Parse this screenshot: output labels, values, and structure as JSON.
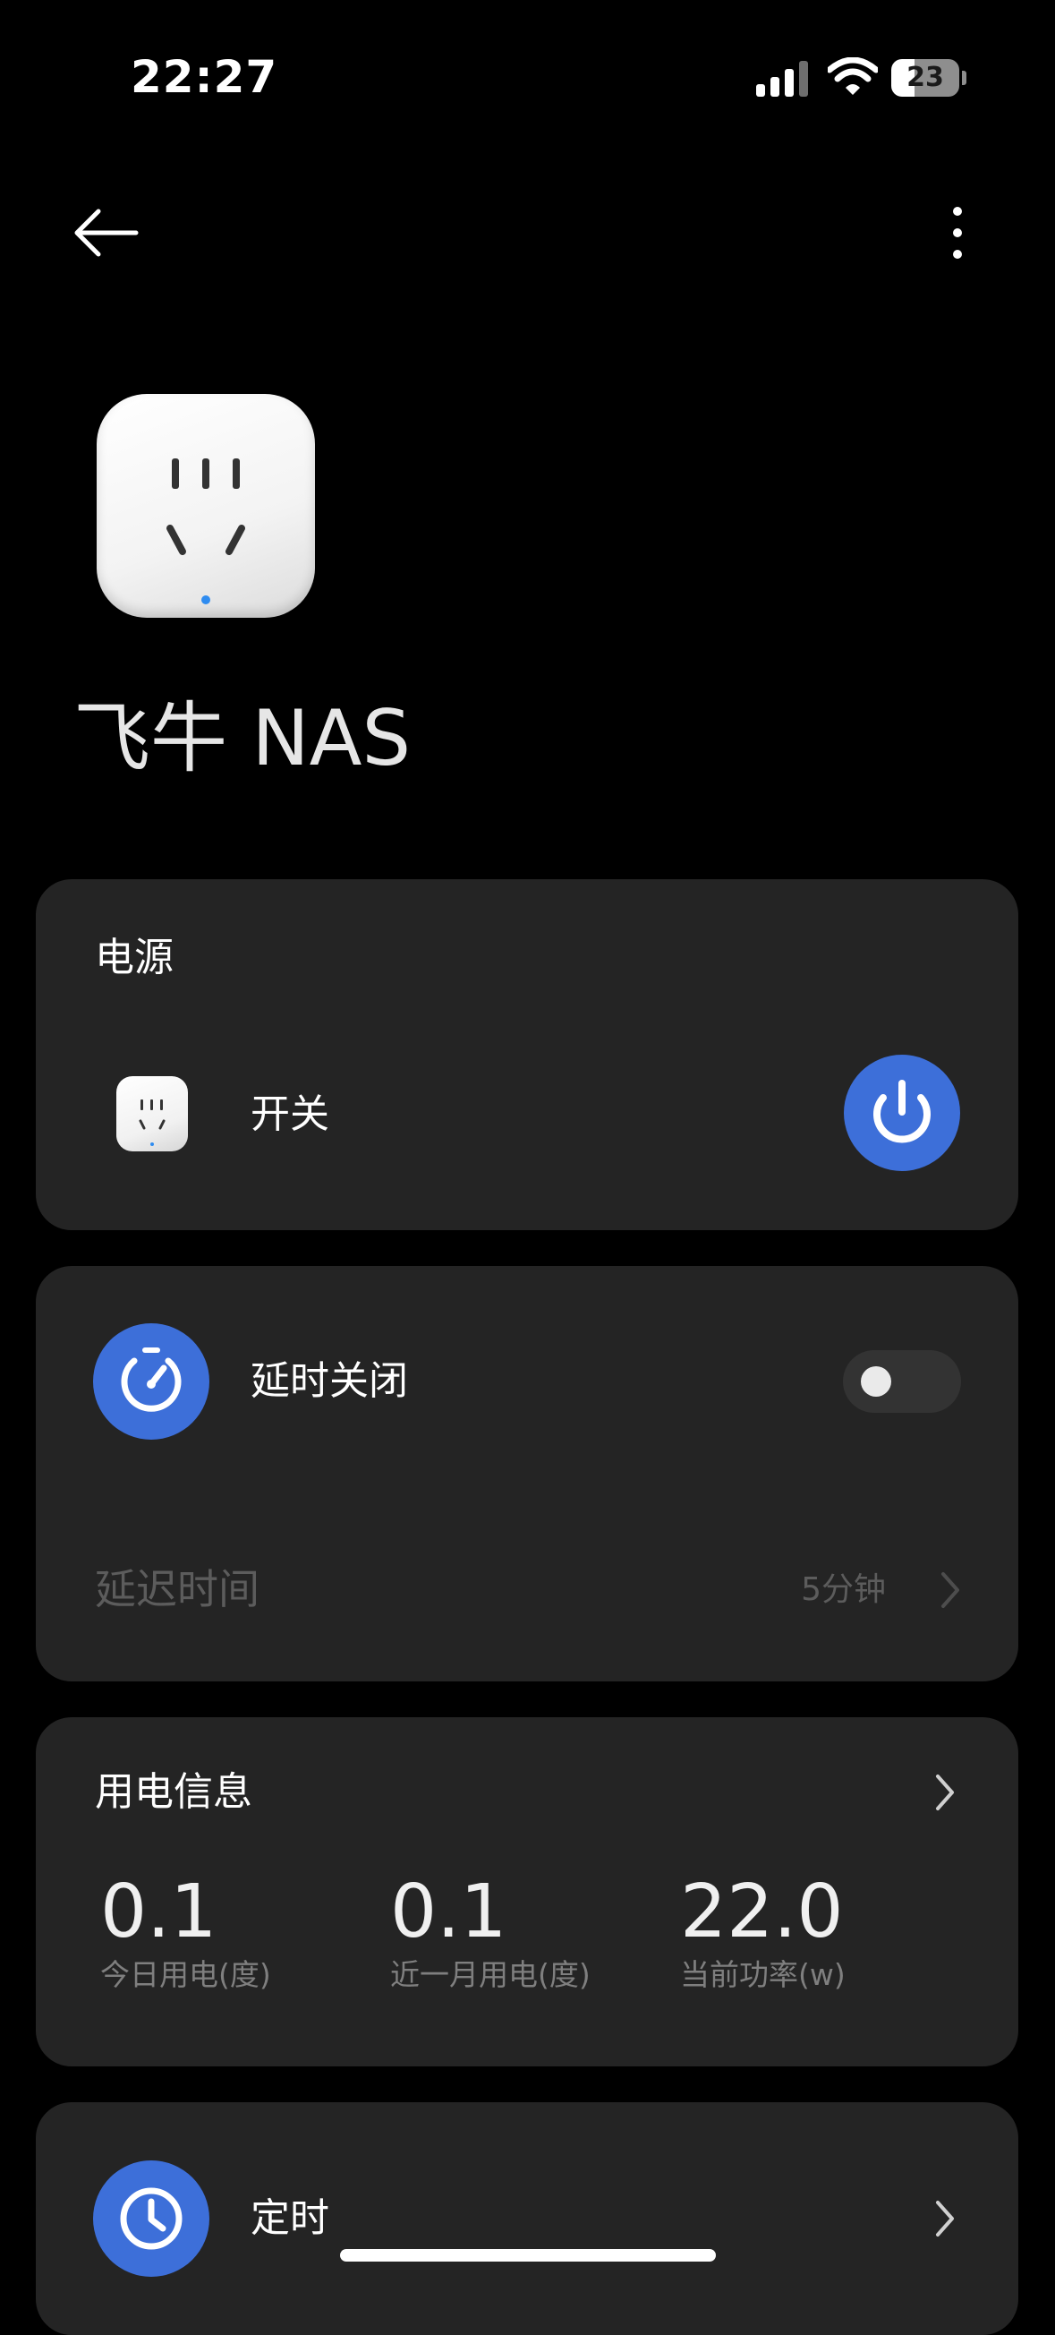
{
  "status_bar": {
    "time": "22:27",
    "battery": "23"
  },
  "header": {
    "back_icon": "arrow-left-icon",
    "more_icon": "vertical-dots-icon"
  },
  "device": {
    "name": "飞牛 NAS",
    "image_icon": "power-socket-icon"
  },
  "power_card": {
    "title": "电源",
    "switch_label": "开关",
    "switch_on": true,
    "accent_color": "#3d6fd9"
  },
  "delay_card": {
    "title": "延时关闭",
    "enabled": false,
    "delay_label": "延迟时间",
    "delay_value": "5分钟"
  },
  "energy_card": {
    "title": "用电信息",
    "metrics": [
      {
        "value": "0.1",
        "label": "今日用电(度)"
      },
      {
        "value": "0.1",
        "label": "近一月用电(度)"
      },
      {
        "value": "22.0",
        "label": "当前功率(w)"
      }
    ]
  },
  "timer_card": {
    "title": "定时"
  },
  "colors": {
    "background": "#000000",
    "card": "#242424",
    "accent": "#3d6fd9",
    "muted_text": "#7f7f7f"
  }
}
